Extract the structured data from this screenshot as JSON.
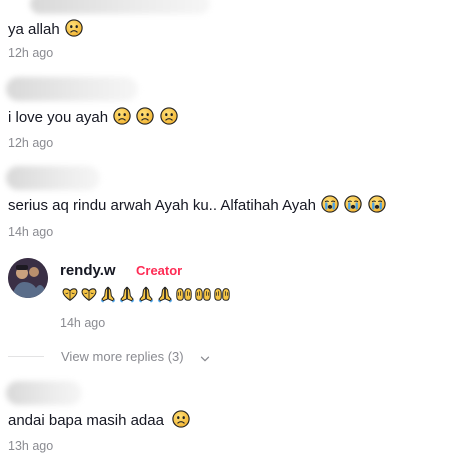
{
  "comments": [
    {
      "text": "ya allah",
      "time": "12h ago"
    },
    {
      "text": "i love you ayah",
      "time": "12h ago"
    },
    {
      "text": "serius aq rindu arwah Ayah ku.. Alfatihah Ayah",
      "time": "14h ago"
    },
    {
      "text": "andai bapa masih adaa",
      "time": "13h ago"
    }
  ],
  "reply": {
    "username": "rendy.w",
    "creator_badge": "Creator",
    "time": "14h ago"
  },
  "view_more": "View more replies (3)",
  "colors": {
    "creator": "#fe2c55",
    "meta": "#8a8b91",
    "text": "#161823"
  },
  "icons": [
    "sad-face-icon",
    "crying-face-icon",
    "heart-hands-icon",
    "praying-hands-icon",
    "open-hands-icon",
    "chevron-down-icon"
  ]
}
